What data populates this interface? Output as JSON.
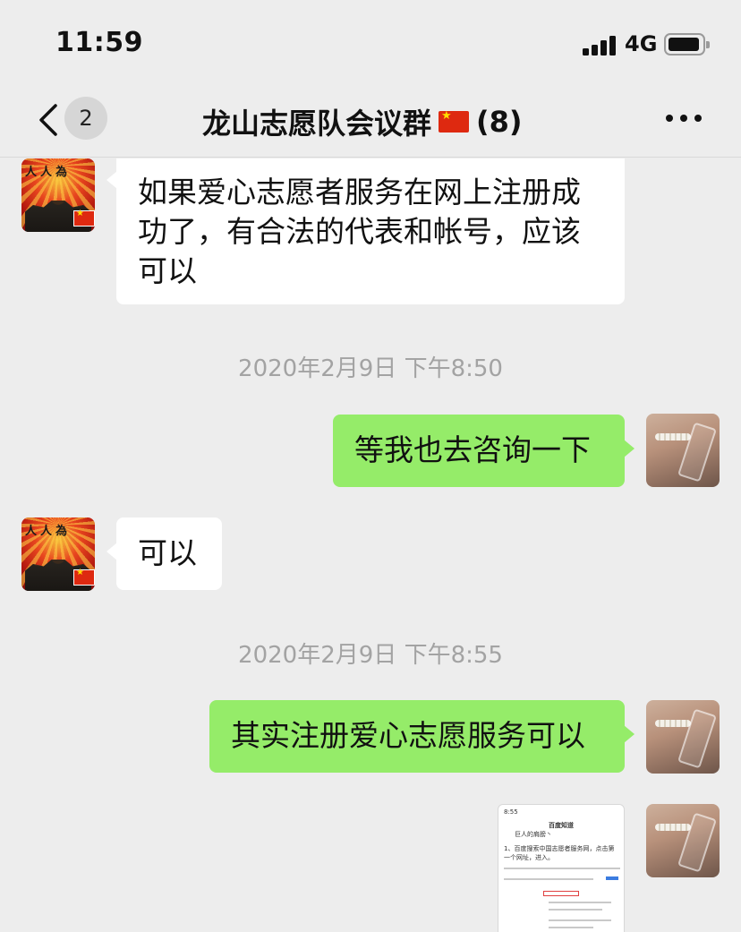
{
  "status_bar": {
    "time": "11:59",
    "network": "4G",
    "battery_level": 0.8
  },
  "nav": {
    "unread_count": "2",
    "title": "龙山志愿队会议群",
    "title_emoji": "china-flag",
    "member_count": "(8)"
  },
  "messages": [
    {
      "sender": "other",
      "text_lines": [
        "如果爱心志愿者服务在网上注册成",
        "功了，有合法的代表和帐号，应该",
        "可以"
      ]
    },
    {
      "timestamp": "2020年2月9日 下午8:50"
    },
    {
      "sender": "me",
      "text": "等我也去咨询一下"
    },
    {
      "sender": "other",
      "text": "可以"
    },
    {
      "timestamp": "2020年2月9日 下午8:55"
    },
    {
      "sender": "me",
      "text": "其实注册爱心志愿服务可以"
    },
    {
      "sender": "me",
      "type": "image",
      "image": {
        "status_time": "8:55",
        "header": "百度知道",
        "user": "巨人的肩膀丶",
        "caption": "1、百度搜索中国志愿者服务网，点击第一个网址，进入。"
      }
    }
  ],
  "colors": {
    "background": "#ededed",
    "bubble_me": "#95ec69",
    "bubble_other": "#ffffff",
    "timestamp_text": "#a3a3a3"
  },
  "icons": [
    "back-chevron-icon",
    "more-options-icon",
    "signal-icon",
    "battery-icon"
  ]
}
